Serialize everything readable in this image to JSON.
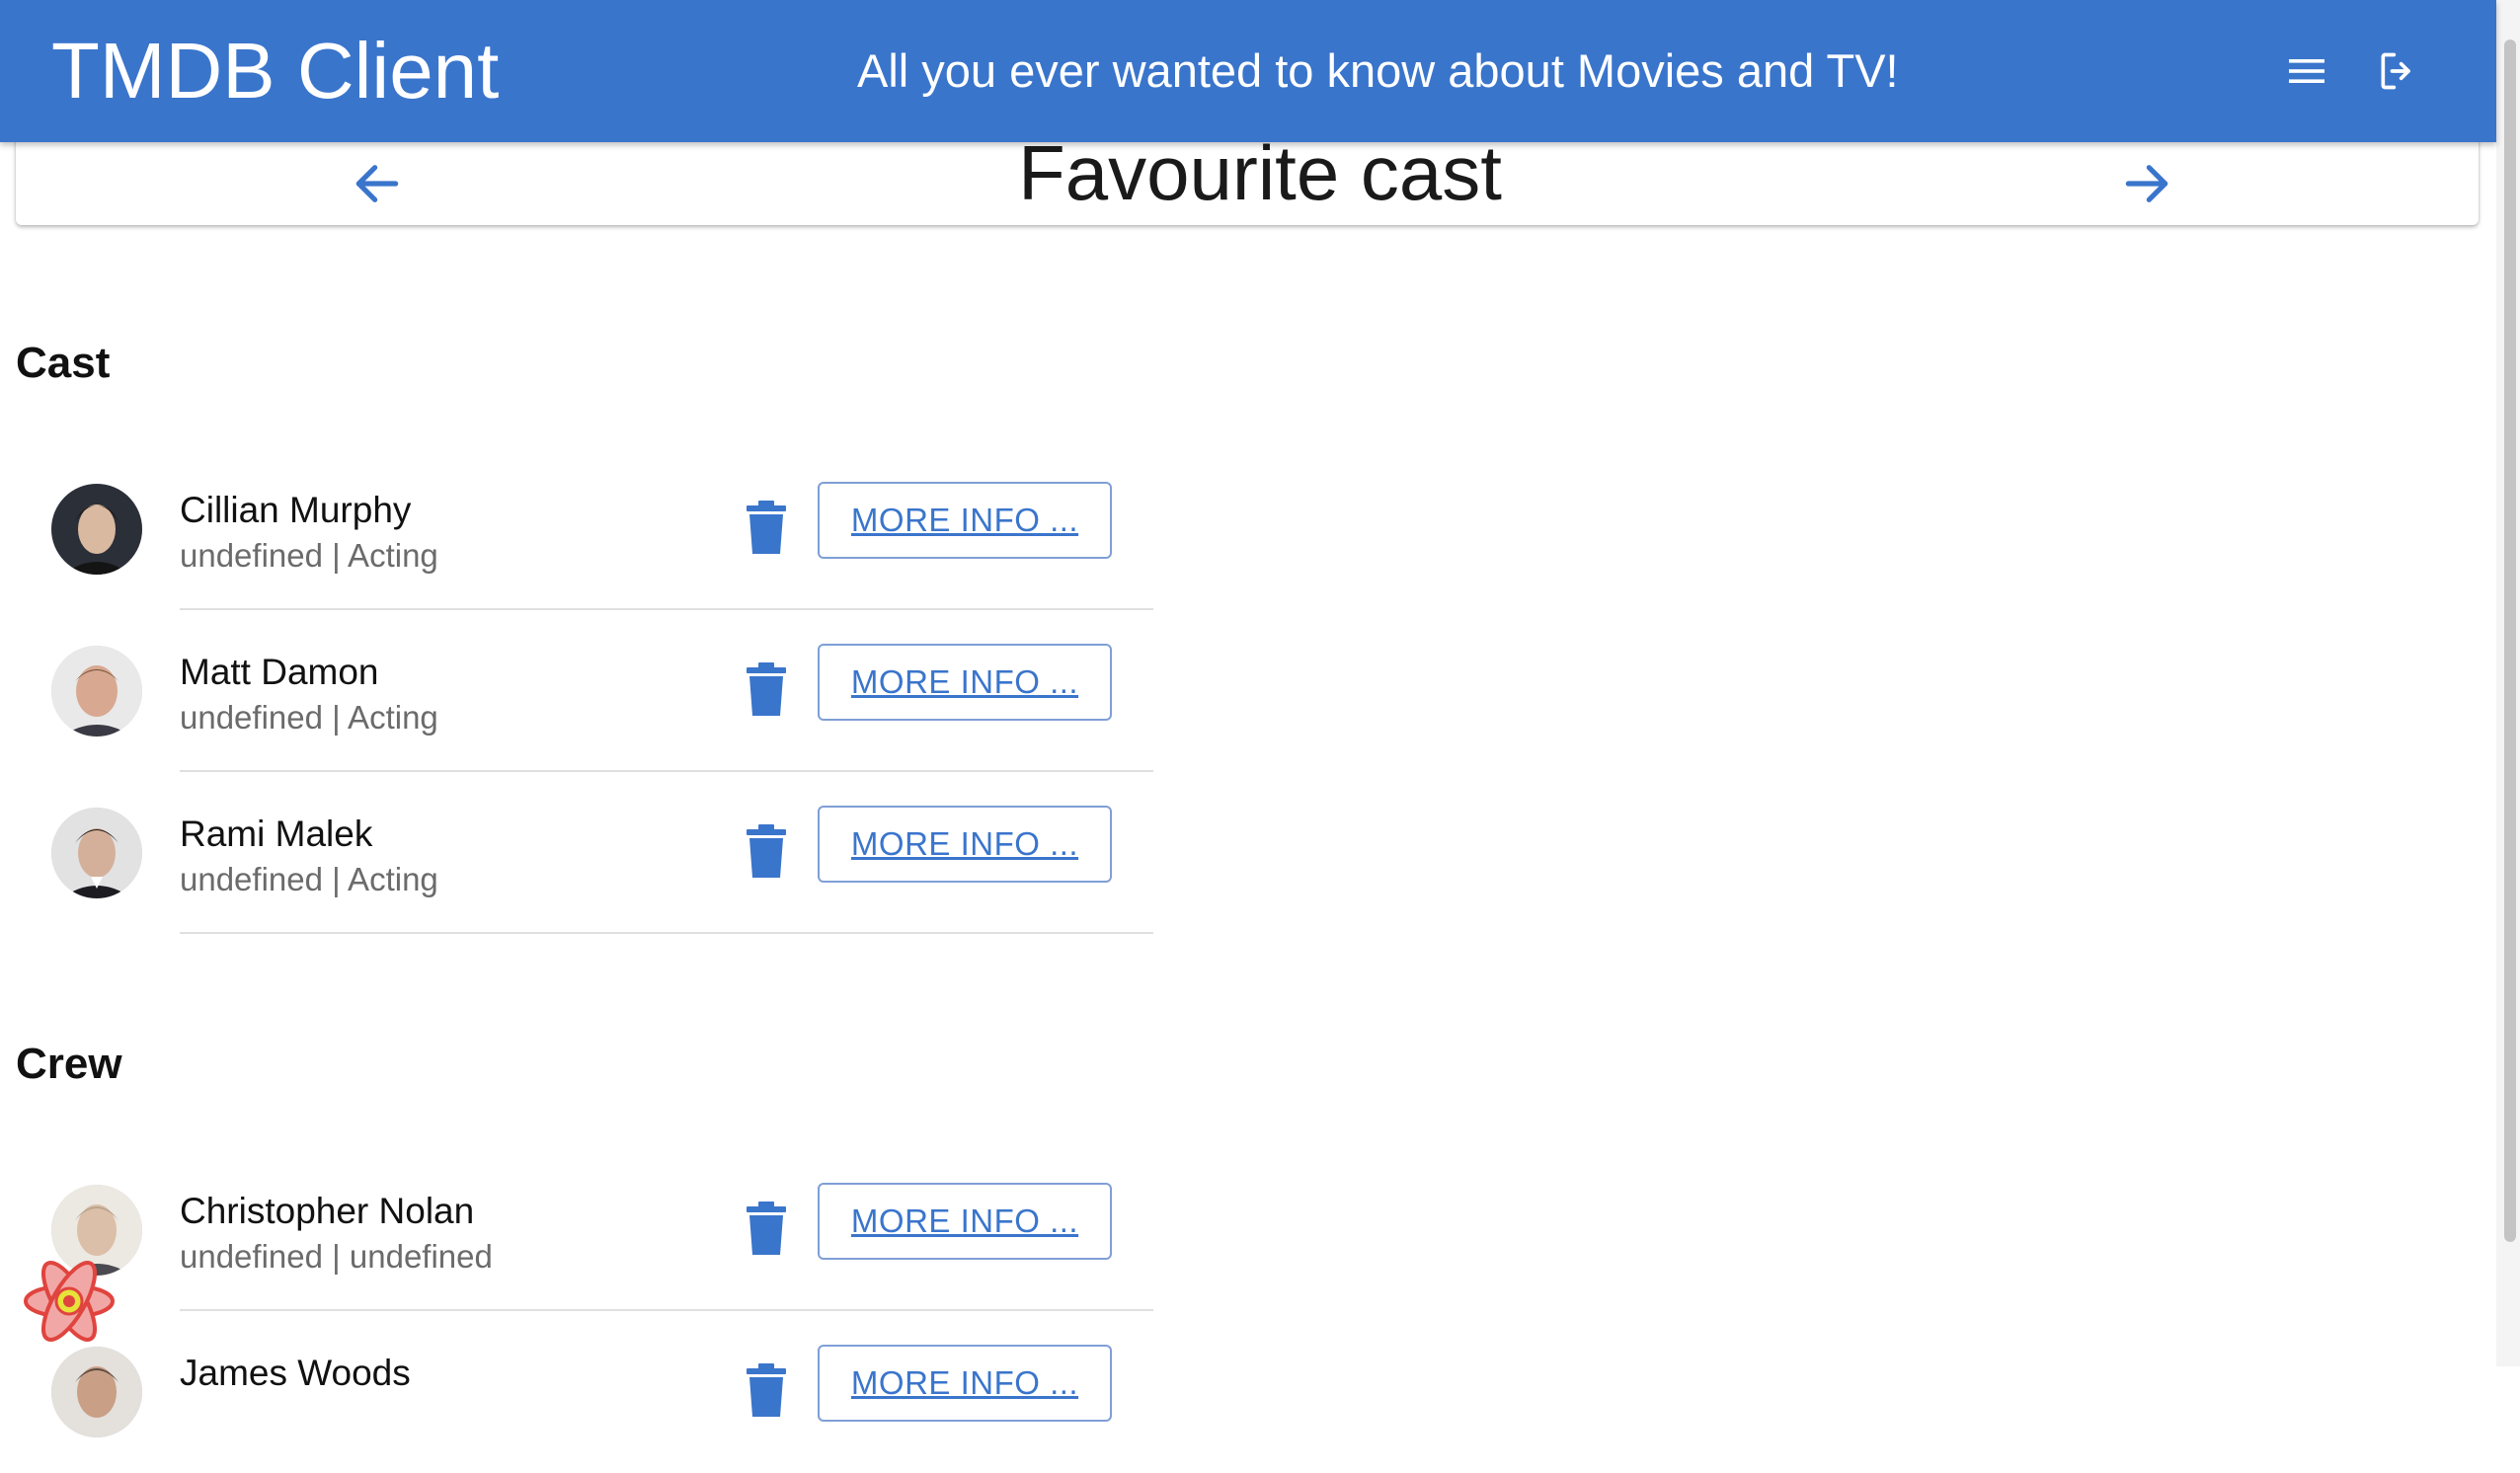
{
  "header": {
    "title": "TMDB Client",
    "tagline": "All you ever wanted to know about Movies and TV!",
    "menu_icon": "menu-icon",
    "logout_icon": "logout-icon"
  },
  "page": {
    "title": "Favourite cast",
    "back_icon": "arrow-left-icon",
    "forward_icon": "arrow-right-icon"
  },
  "sections": {
    "cast_title": "Cast",
    "crew_title": "Crew"
  },
  "cast": [
    {
      "name": "Cillian Murphy",
      "subtitle": "undefined | Acting",
      "button": "MORE INFO ..."
    },
    {
      "name": "Matt Damon",
      "subtitle": "undefined | Acting",
      "button": "MORE INFO ..."
    },
    {
      "name": "Rami Malek",
      "subtitle": "undefined | Acting",
      "button": "MORE INFO ..."
    }
  ],
  "crew": [
    {
      "name": "Christopher Nolan",
      "subtitle": "undefined | undefined",
      "button": "MORE INFO ..."
    },
    {
      "name": "James Woods",
      "subtitle": "",
      "button": "MORE INFO ..."
    }
  ],
  "colors": {
    "primary": "#3a75cc",
    "subtext": "#6b6b6b",
    "divider": "#e0e0e0"
  }
}
